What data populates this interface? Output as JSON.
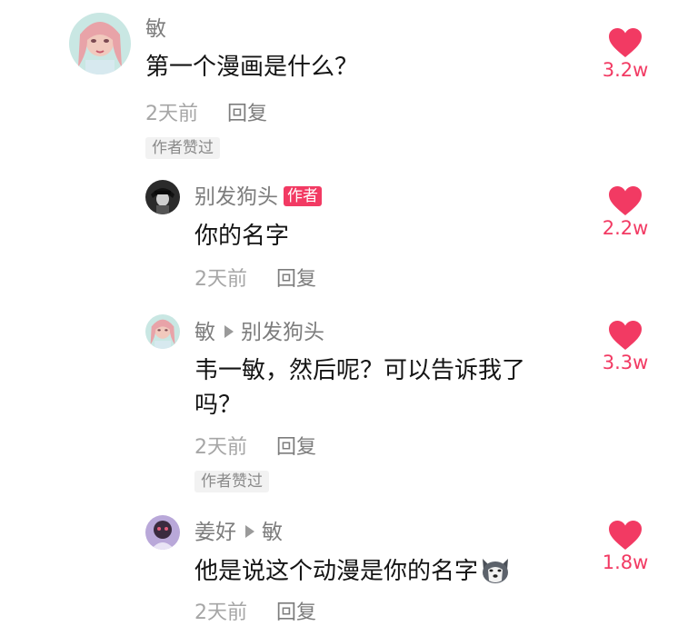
{
  "colors": {
    "accent_pink": "#f23a63",
    "meta_gray": "#a6a6a6",
    "username_gray": "#7d7d7d"
  },
  "comments": [
    {
      "username": "敏",
      "content": "第一个漫画是什么？",
      "time": "2天前",
      "reply_label": "回复",
      "liked_by_author": "作者赞过",
      "likes": "3.2w"
    },
    {
      "username": "别发狗头",
      "author_badge": "作者",
      "content": "你的名字",
      "time": "2天前",
      "reply_label": "回复",
      "likes": "2.2w"
    },
    {
      "username": "敏",
      "reply_to": "别发狗头",
      "content_line1": "韦一敏，然后呢？可以告诉我了",
      "content_line2": "吗？",
      "time": "2天前",
      "reply_label": "回复",
      "liked_by_author": "作者赞过",
      "likes": "3.3w"
    },
    {
      "username": "姜好",
      "reply_to": "敏",
      "content": "他是说这个动漫是你的名字",
      "emoji": "dog-emoji",
      "time": "2天前",
      "reply_label": "回复",
      "likes": "1.8w"
    }
  ]
}
